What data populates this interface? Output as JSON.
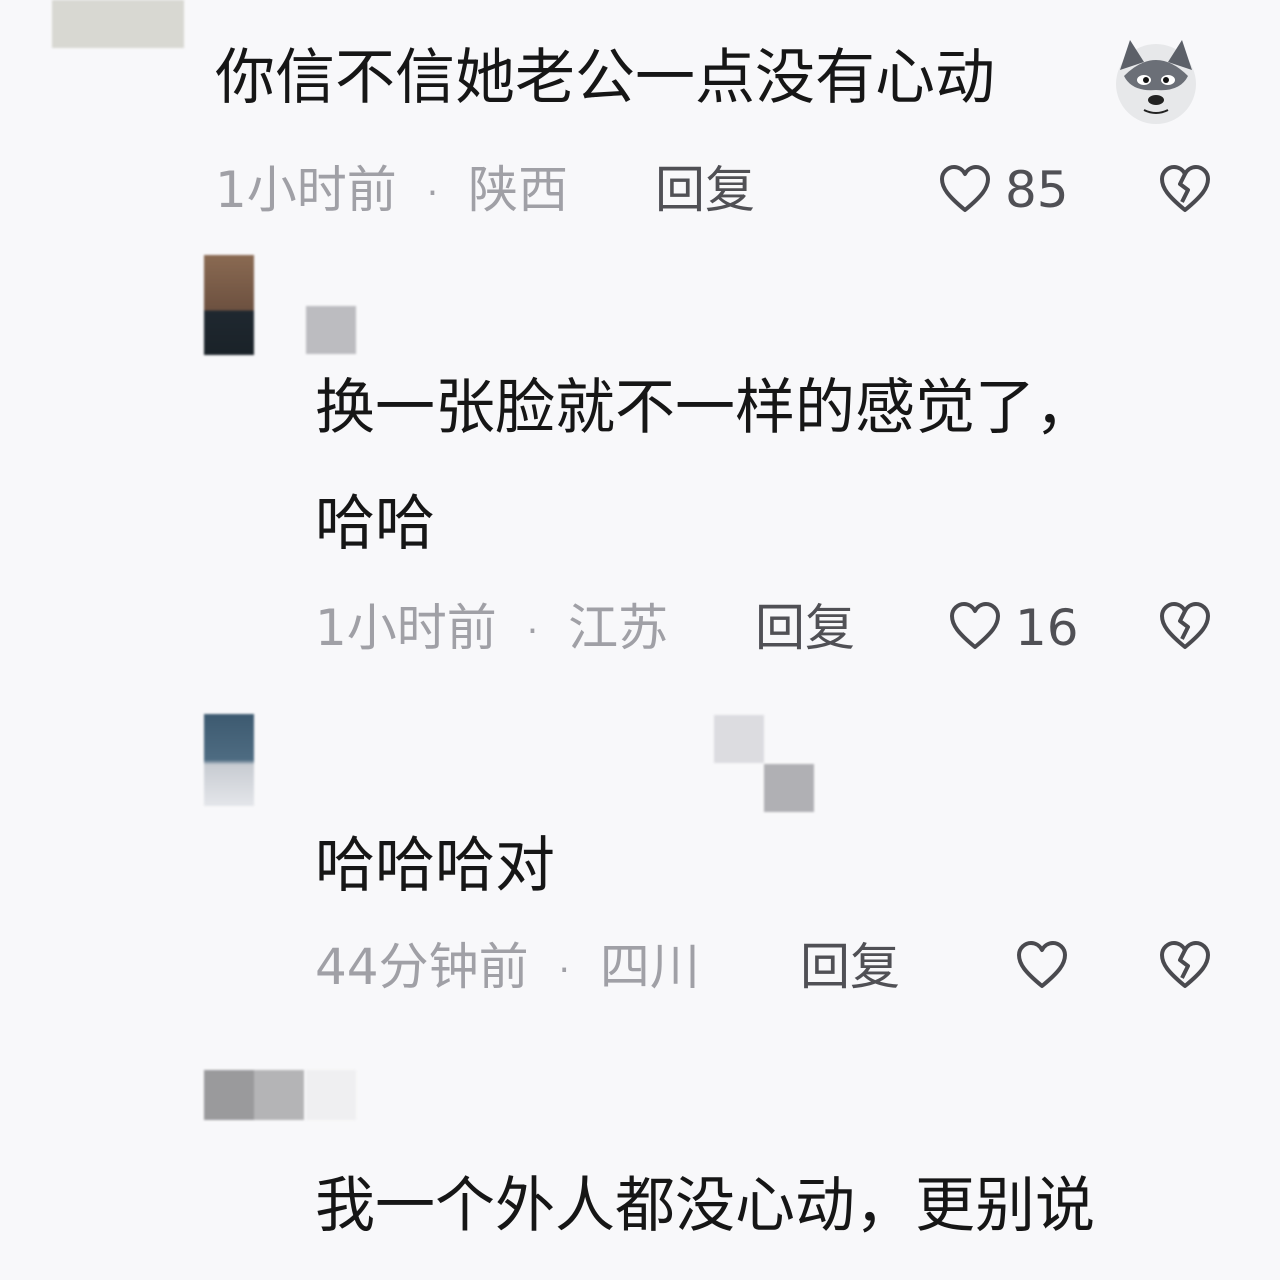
{
  "comments": [
    {
      "text": "你信不信她老公一点没有心动",
      "emoji": "husky-dog-emoji",
      "time": "1小时前",
      "location": "陕西",
      "reply_label": "回复",
      "likes": "85"
    },
    {
      "text_line1": "换一张脸就不一样的感觉了，",
      "text_line2": "哈哈",
      "time": "1小时前",
      "location": "江苏",
      "reply_label": "回复",
      "likes": "16"
    },
    {
      "text": "哈哈哈对",
      "time": "44分钟前",
      "location": "四川",
      "reply_label": "回复",
      "likes": ""
    },
    {
      "text": "我一个外人都没心动，更别说"
    }
  ],
  "separator": "·",
  "icons": {
    "like": "heart-outline-icon",
    "dislike": "broken-heart-icon"
  }
}
